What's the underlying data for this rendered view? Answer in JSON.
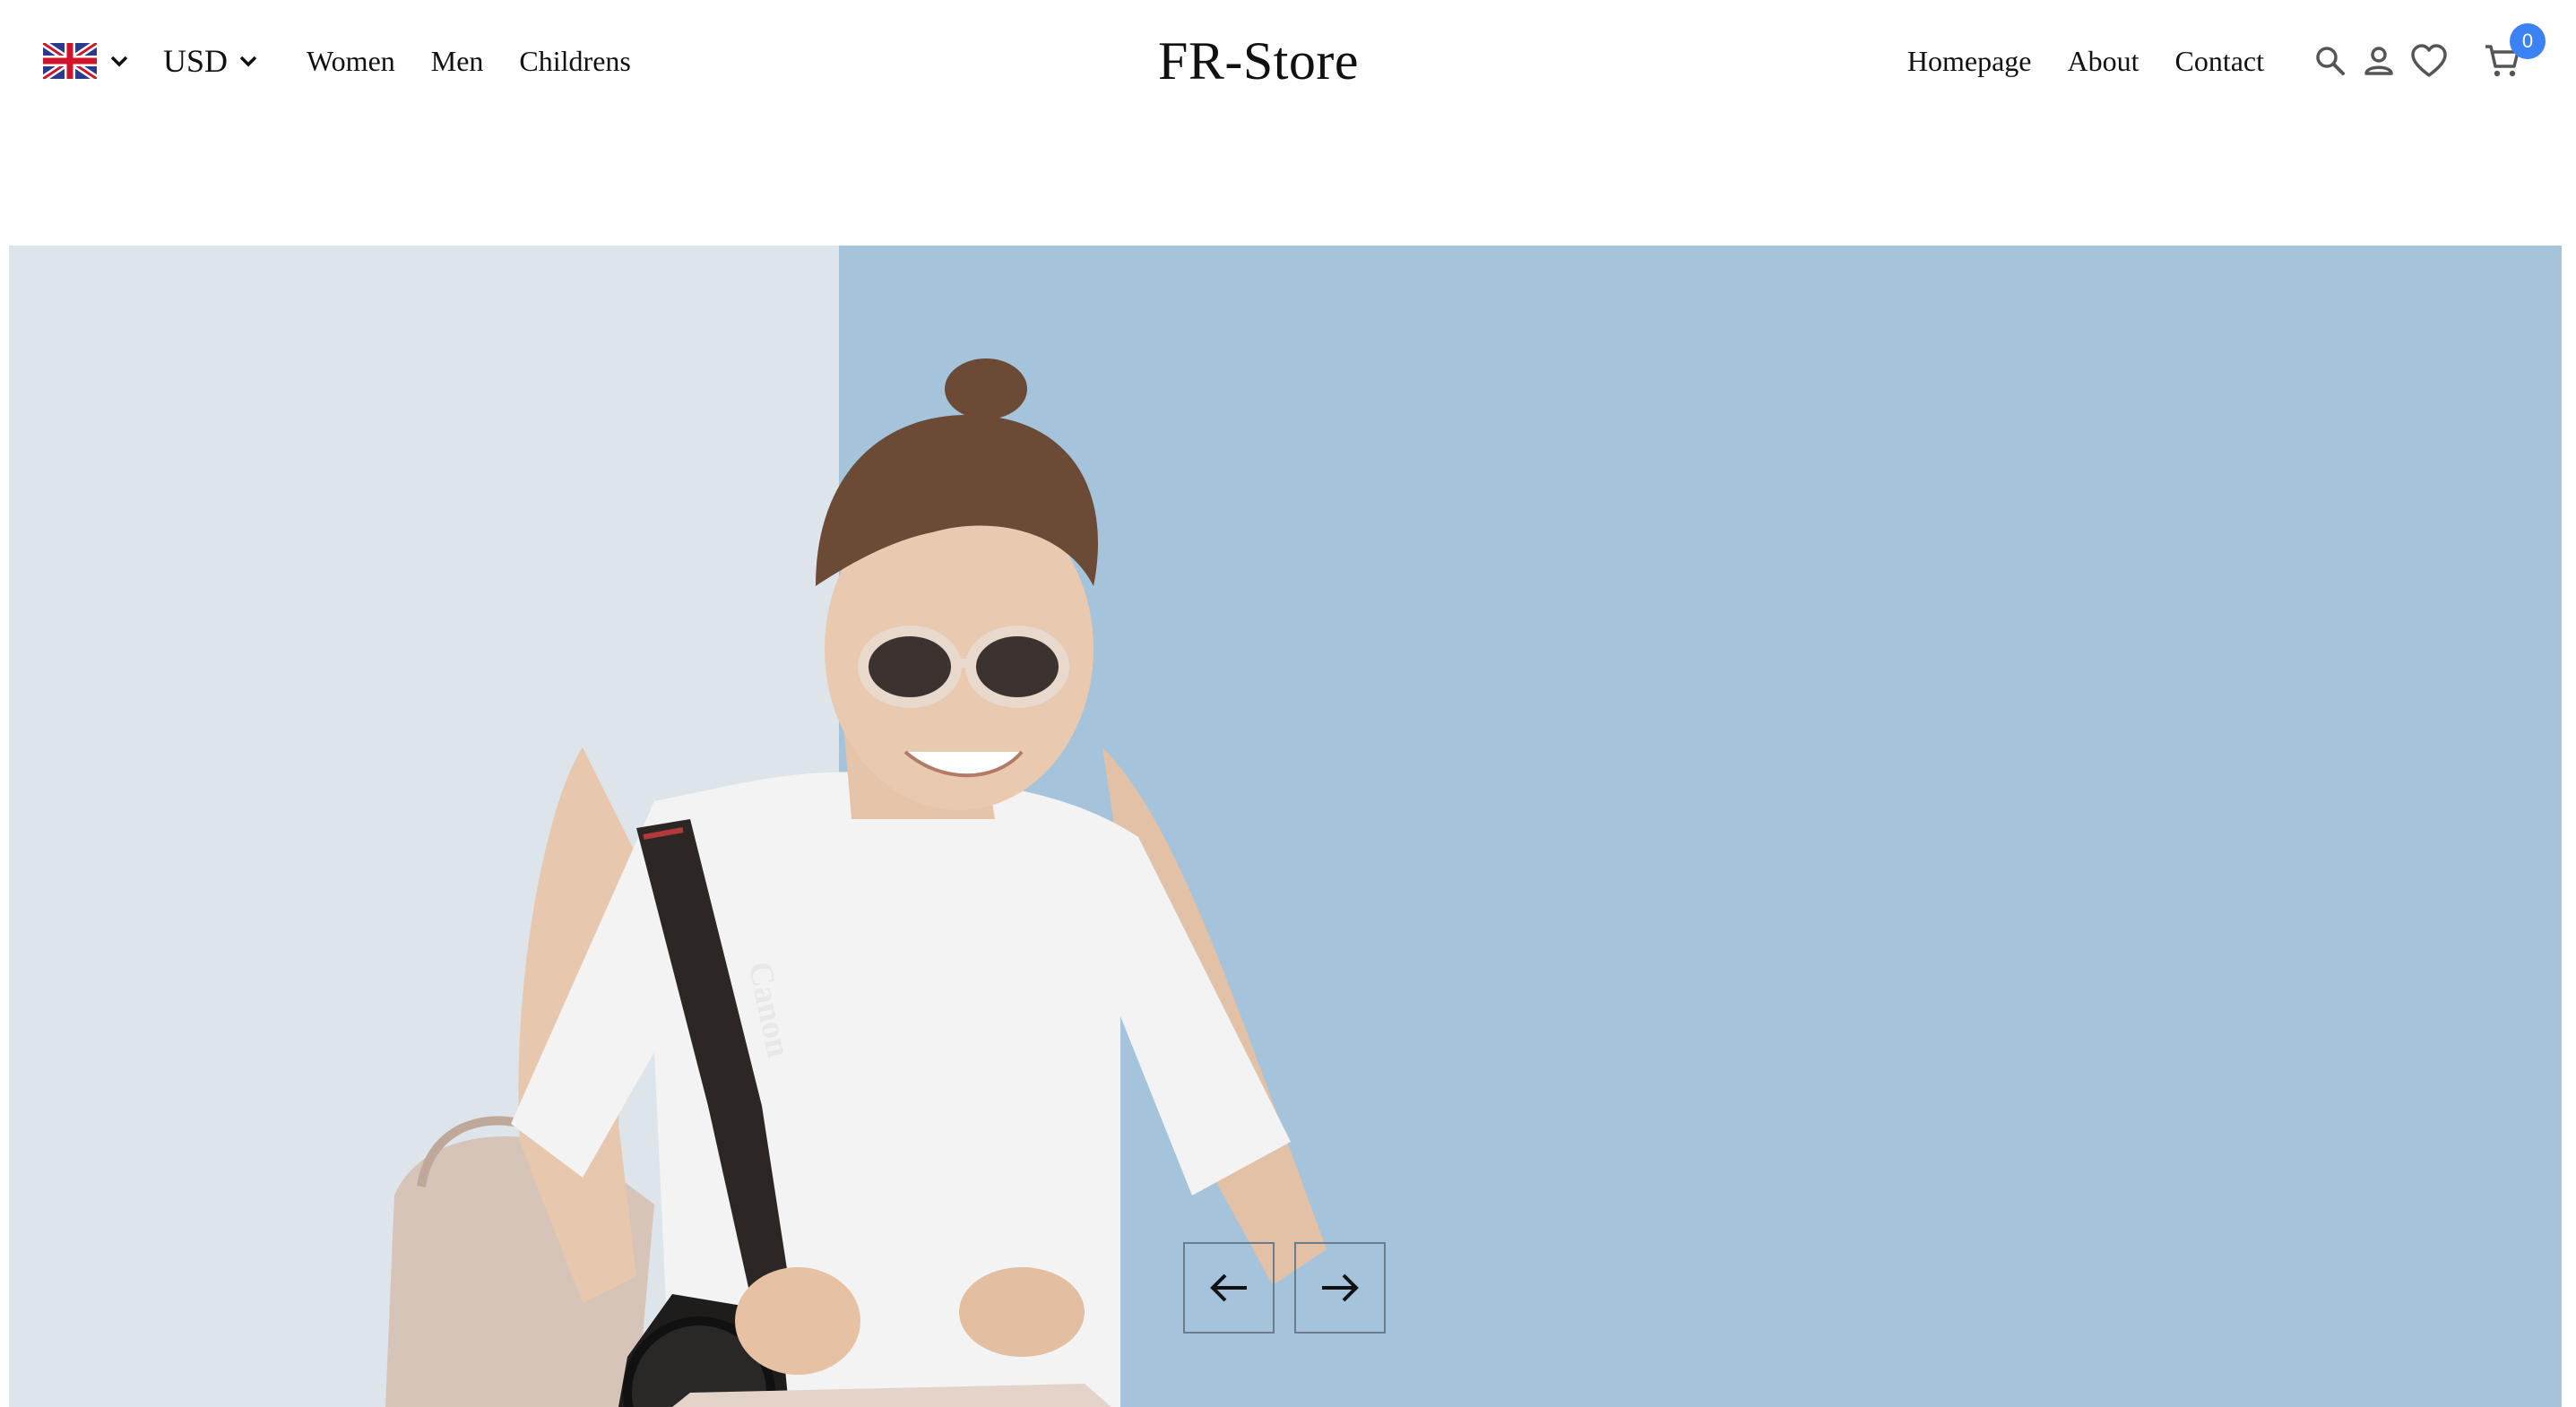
{
  "header": {
    "language": {
      "flag_icon": "uk-flag-icon",
      "chevron_icon": "chevron-down-icon"
    },
    "currency": {
      "value": "USD",
      "chevron_icon": "chevron-down-icon"
    },
    "nav_left": [
      {
        "label": "Women"
      },
      {
        "label": "Men"
      },
      {
        "label": "Childrens"
      }
    ],
    "logo": "FR-Store",
    "nav_right": [
      {
        "label": "Homepage"
      },
      {
        "label": "About"
      },
      {
        "label": "Contact"
      }
    ],
    "icons": [
      "search-icon",
      "user-icon",
      "heart-icon",
      "cart-icon"
    ],
    "cart_count": "0",
    "badge_color": "#3b82f6"
  },
  "hero": {
    "image": "woman-with-camera-photo",
    "wall_colors": {
      "left": "#dde4ea",
      "right": "#a5c3da"
    },
    "prev_icon": "arrow-left-icon",
    "next_icon": "arrow-right-icon"
  }
}
